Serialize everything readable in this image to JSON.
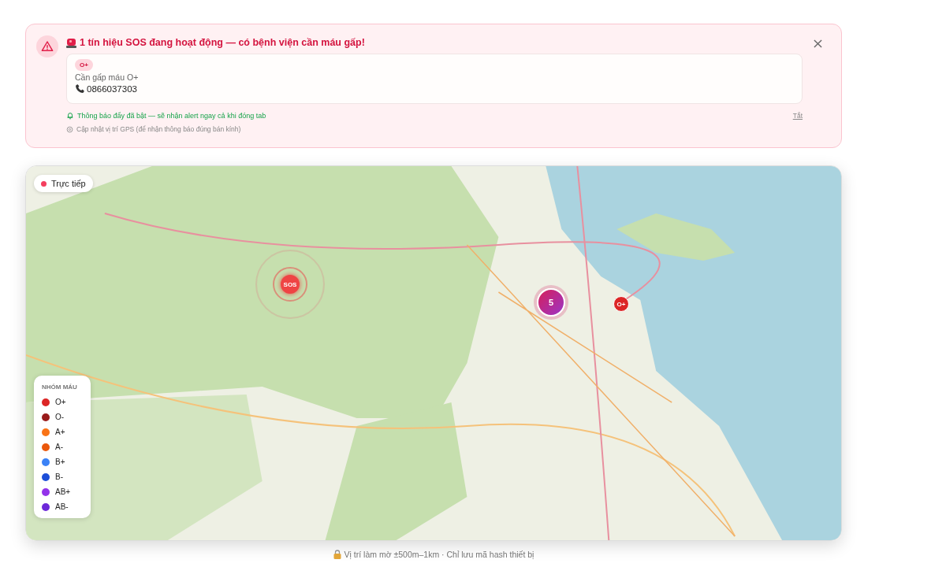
{
  "alert": {
    "title": "1 tín hiệu SOS đang hoạt động — có bệnh viện cần máu gấp!",
    "request": {
      "blood_type": "O+",
      "message": "Cần gấp máu O+",
      "phone": "0866037303"
    },
    "push_status": "Thông báo đẩy đã bật — sẽ nhận alert ngay cả khi đóng tab",
    "push_off_link": "Tắt",
    "gps_note": "Cập nhật vị trí GPS (để nhận thông báo đúng bán kính)"
  },
  "map": {
    "live_badge": "Trực tiếp",
    "markers": [
      {
        "kind": "sos",
        "label": "SOS"
      },
      {
        "kind": "cluster",
        "label": "5"
      },
      {
        "kind": "pin",
        "label": "O+"
      }
    ],
    "legend": {
      "title": "NHÓM MÁU",
      "items": [
        {
          "label": "O+",
          "color": "#dc2626"
        },
        {
          "label": "O-",
          "color": "#991b1b"
        },
        {
          "label": "A+",
          "color": "#f97316"
        },
        {
          "label": "A-",
          "color": "#ea580c"
        },
        {
          "label": "B+",
          "color": "#3b82f6"
        },
        {
          "label": "B-",
          "color": "#1d4ed8"
        },
        {
          "label": "AB+",
          "color": "#9333ea"
        },
        {
          "label": "AB-",
          "color": "#6d28d9"
        }
      ]
    }
  },
  "footer": "Vị trí làm mờ ±500m–1km · Chỉ lưu mã hash thiết bị"
}
